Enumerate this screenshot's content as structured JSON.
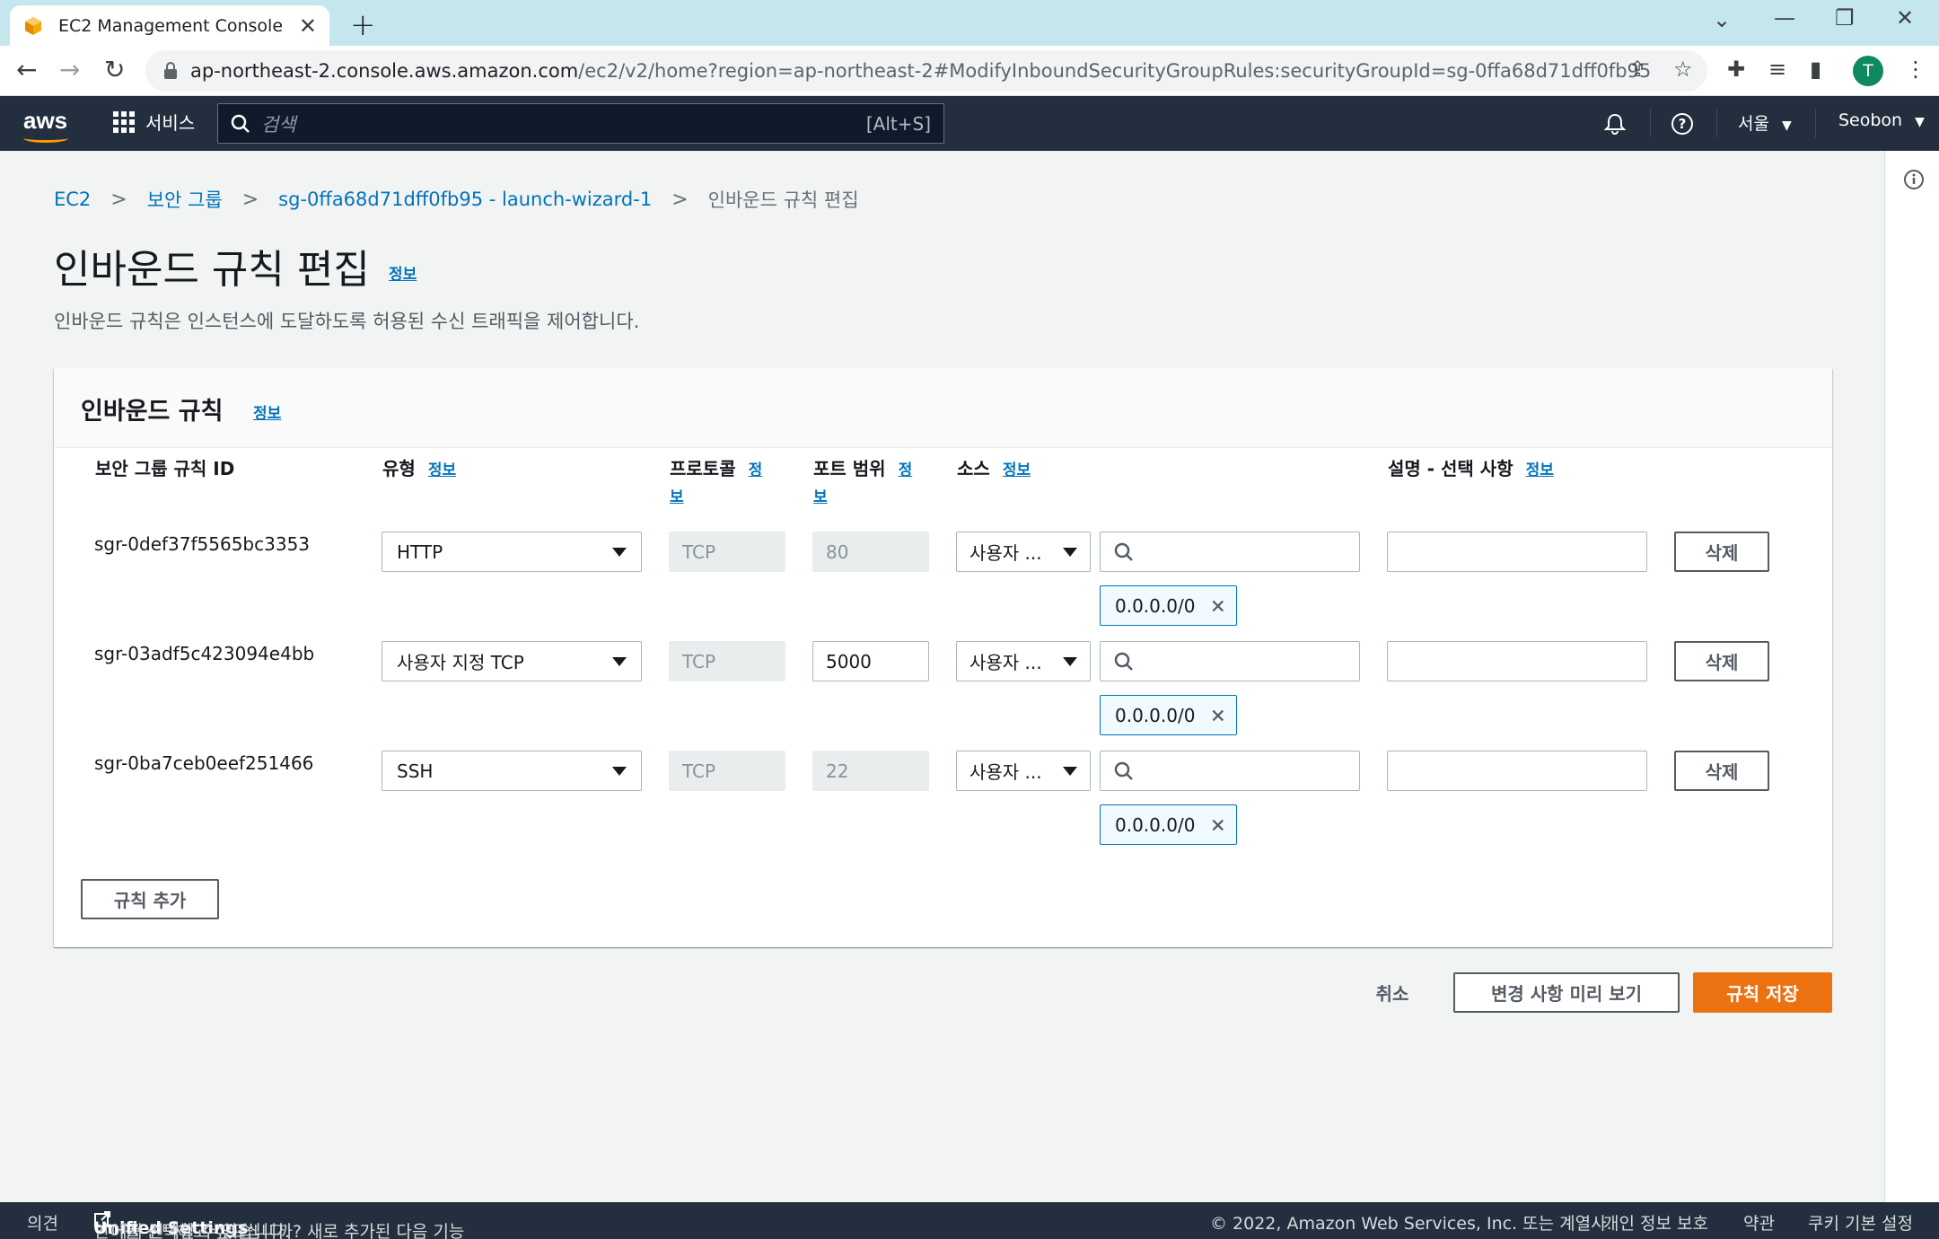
{
  "browser": {
    "tab_title": "EC2 Management Console",
    "url_host": "ap-northeast-2.console.aws.amazon.com",
    "url_path": "/ec2/v2/home?region=ap-northeast-2#ModifyInboundSecurityGroupRules:securityGroupId=sg-0ffa68d71dff0fb95",
    "profile_initial": "T"
  },
  "aws_nav": {
    "logo": "aws",
    "services_label": "서비스",
    "search_placeholder": "검색",
    "search_shortcut": "[Alt+S]",
    "region": "서울",
    "user": "Seobon"
  },
  "breadcrumb": [
    "EC2",
    "보안 그룹",
    "sg-0ffa68d71dff0fb95 - launch-wizard-1",
    "인바운드 규칙 편집"
  ],
  "page": {
    "title": "인바운드 규칙 편집",
    "info_label": "정보",
    "description": "인바운드 규칙은 인스턴스에 도달하도록 허용된 수신 트래픽을 제어합니다."
  },
  "panel": {
    "title": "인바운드 규칙",
    "info_label": "정보",
    "columns": {
      "rule_id": "보안 그룹 규칙 ID",
      "type": "유형",
      "protocol": "프로토콜",
      "port": "포트 범위",
      "source": "소스",
      "description": "설명 - 선택 사항"
    },
    "info_split": {
      "a": "정",
      "b": "보"
    },
    "rules": [
      {
        "id": "sgr-0def37f5565bc3353",
        "type": "HTTP",
        "protocol": "TCP",
        "port": "80",
        "port_editable": false,
        "source_type": "사용자 ...",
        "cidr": "0.0.0.0/0",
        "delete_label": "삭제"
      },
      {
        "id": "sgr-03adf5c423094e4bb",
        "type": "사용자 지정 TCP",
        "protocol": "TCP",
        "port": "5000",
        "port_editable": true,
        "source_type": "사용자 ...",
        "cidr": "0.0.0.0/0",
        "delete_label": "삭제"
      },
      {
        "id": "sgr-0ba7ceb0eef251466",
        "type": "SSH",
        "protocol": "TCP",
        "port": "22",
        "port_editable": false,
        "source_type": "사용자 ...",
        "cidr": "0.0.0.0/0",
        "delete_label": "삭제"
      }
    ],
    "add_rule_label": "규칙 추가"
  },
  "actions": {
    "cancel": "취소",
    "preview": "변경 사항 미리 보기",
    "save": "규칙 저장"
  },
  "footer": {
    "feedback": "의견",
    "language_prompt": "언어를 선택하고 싶으십니까? 새로 추가된 다음 기능",
    "unified_settings": "Unified Settings",
    "language_suffix": "에서 선택할 수 있습니다.",
    "copyright": "© 2022, Amazon Web Services, Inc. 또는 계열사.",
    "privacy": "개인 정보 보호",
    "terms": "약관",
    "cookies": "쿠키 기본 설정"
  },
  "colors": {
    "accent": "#ec7211",
    "link": "#0073bb",
    "nav_bg": "#232f3e"
  }
}
